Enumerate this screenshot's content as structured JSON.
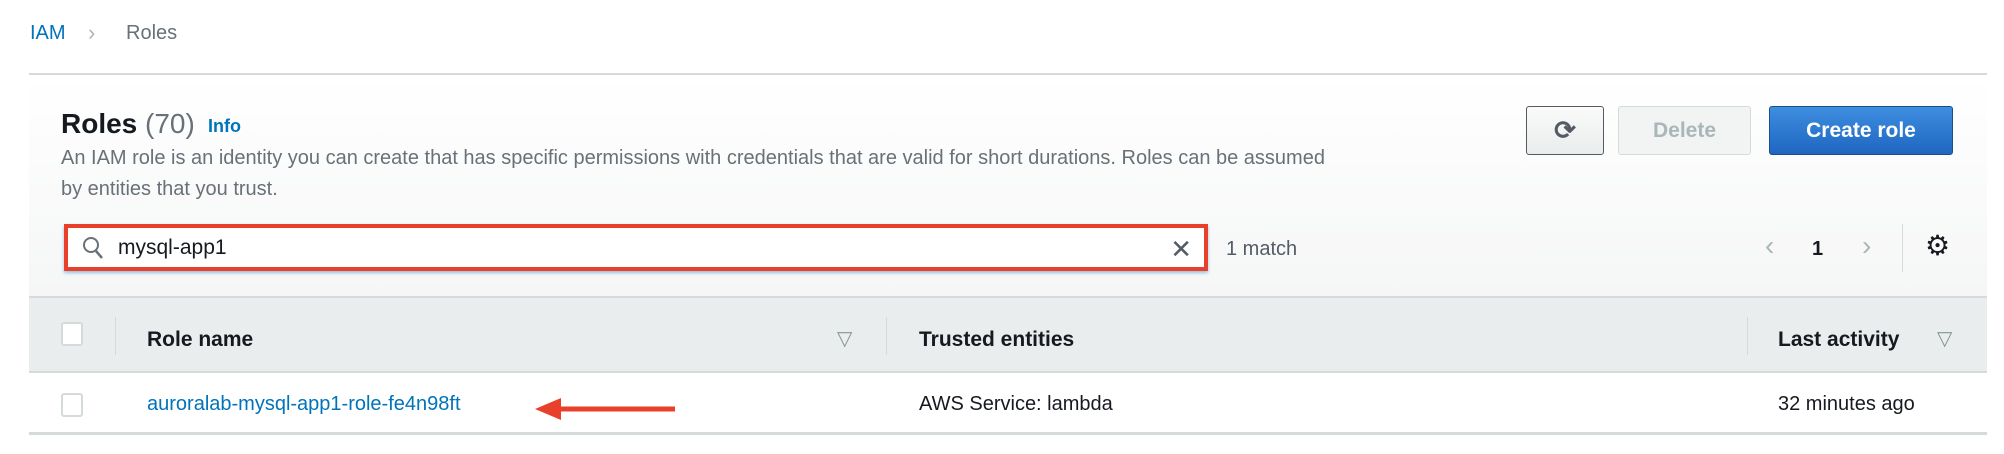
{
  "breadcrumb": {
    "root": "IAM",
    "separator": "›",
    "current": "Roles"
  },
  "panel": {
    "title": "Roles",
    "count": "(70)",
    "info_label": "Info",
    "description": "An IAM role is an identity you can create that has specific permissions with credentials that are valid for short durations. Roles can be assumed by entities that you trust.",
    "buttons": {
      "refresh_icon": "refresh-icon",
      "delete": "Delete",
      "create": "Create role"
    },
    "search": {
      "value": "mysql-app1",
      "match_text": "1 match"
    },
    "pagination": {
      "prev": "‹",
      "page": "1",
      "next": "›"
    }
  },
  "table": {
    "columns": [
      "Role name",
      "Trusted entities",
      "Last activity"
    ],
    "rows": [
      {
        "role_name": "auroralab-mysql-app1-role-fe4n98ft",
        "trusted_entities": "AWS Service: lambda",
        "last_activity": "32 minutes ago"
      }
    ]
  },
  "colors": {
    "link": "#0073bb",
    "primary": "#1f66c1",
    "annotation": "#e8402a"
  }
}
